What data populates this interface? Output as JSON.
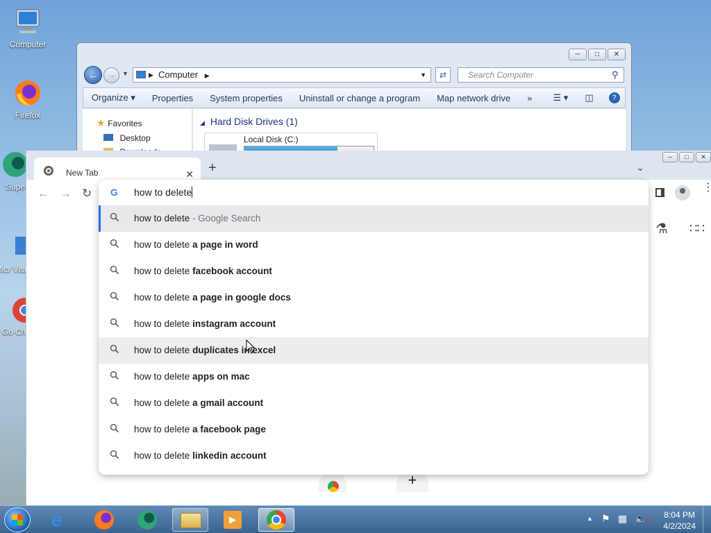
{
  "desktop": {
    "icons": [
      {
        "label": "Computer"
      },
      {
        "label": "Firefox"
      },
      {
        "label": "Supe"
      },
      {
        "label": "Micr Visual"
      },
      {
        "label": "Go Chr"
      }
    ]
  },
  "explorer": {
    "address": "Computer",
    "search_placeholder": "Search Computer",
    "toolbar": [
      "Organize ▾",
      "Properties",
      "System properties",
      "Uninstall or change a program",
      "Map network drive",
      "»"
    ],
    "nav": {
      "favorites": "Favorites",
      "desktop": "Desktop",
      "downloads": "Downloads"
    },
    "section_title": "Hard Disk Drives (1)",
    "disk_label": "Local Disk (C:)",
    "disk_used_fraction": 0.72
  },
  "chrome": {
    "tab_title": "New Tab",
    "omnibox_text": "how to delete",
    "suggestions": [
      {
        "prefix": "how to delete",
        "bold": "",
        "suffix": " - Google Search"
      },
      {
        "prefix": "how to delete ",
        "bold": "a page in word",
        "suffix": ""
      },
      {
        "prefix": "how to delete ",
        "bold": "facebook account",
        "suffix": ""
      },
      {
        "prefix": "how to delete ",
        "bold": "a page in google docs",
        "suffix": ""
      },
      {
        "prefix": "how to delete ",
        "bold": "instagram account",
        "suffix": ""
      },
      {
        "prefix": "how to delete ",
        "bold": "duplicates in excel",
        "suffix": ""
      },
      {
        "prefix": "how to delete ",
        "bold": "apps on mac",
        "suffix": ""
      },
      {
        "prefix": "how to delete ",
        "bold": "a gmail account",
        "suffix": ""
      },
      {
        "prefix": "how to delete ",
        "bold": "a facebook page",
        "suffix": ""
      },
      {
        "prefix": "how to delete ",
        "bold": "linkedin account",
        "suffix": ""
      }
    ]
  },
  "taskbar": {
    "time": "8:04 PM",
    "date": "4/2/2024"
  },
  "colors": {
    "accent": "#1a73e8",
    "taskbar": "#3a6491"
  }
}
